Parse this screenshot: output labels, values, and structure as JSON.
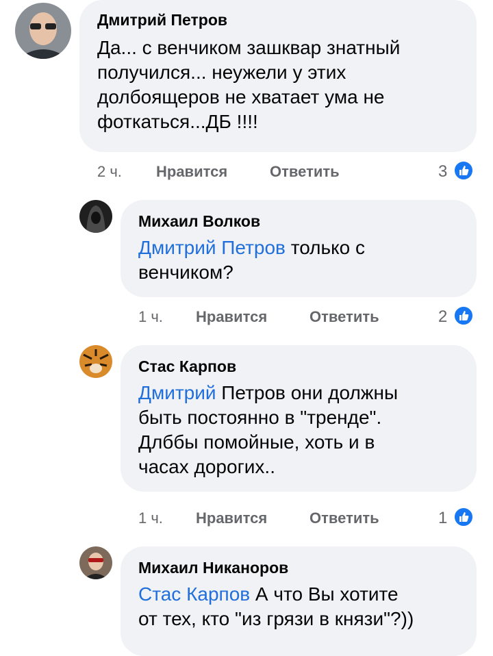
{
  "comments": [
    {
      "author": "Дмитрий Петров",
      "lines": [
        {
          "mention": "",
          "text": "Да... с венчиком зашквар знатный"
        },
        {
          "mention": "",
          "text": "получился... неужели у этих"
        },
        {
          "mention": "",
          "text": "долбоящеров не хватает ума не"
        },
        {
          "mention": "",
          "text": "фоткаться...ДБ !!!!"
        }
      ],
      "time": "2 ч.",
      "like_label": "Нравится",
      "reply_label": "Ответить",
      "reactions": "3"
    },
    {
      "author": "Михаил Волков",
      "lines": [
        {
          "mention": "Дмитрий Петров",
          "text": " только с"
        },
        {
          "mention": "",
          "text": "венчиком?"
        }
      ],
      "time": "1 ч.",
      "like_label": "Нравится",
      "reply_label": "Ответить",
      "reactions": "2"
    },
    {
      "author": "Стас Карпов",
      "lines": [
        {
          "mention": "Дмитрий",
          "text": " Петров они должны"
        },
        {
          "mention": "",
          "text": "быть постоянно в \"тренде\"."
        },
        {
          "mention": "",
          "text": "Длббы помойные, хоть и в"
        },
        {
          "mention": "",
          "text": "часах дорогих.."
        }
      ],
      "time": "1 ч.",
      "like_label": "Нравится",
      "reply_label": "Ответить",
      "reactions": "1"
    },
    {
      "author": "Михаил Никаноров",
      "lines": [
        {
          "mention": "Стас Карпов",
          "text": " А что Вы хотите"
        },
        {
          "mention": "",
          "text": "от тех, кто \"из грязи в князи\"?))"
        }
      ]
    }
  ],
  "icons": {
    "reaction": "like-thumb-icon"
  },
  "colors": {
    "bubble": "#f0f2f5",
    "mention": "#216fdb",
    "meta": "#65676b",
    "like": "#1877f2"
  }
}
